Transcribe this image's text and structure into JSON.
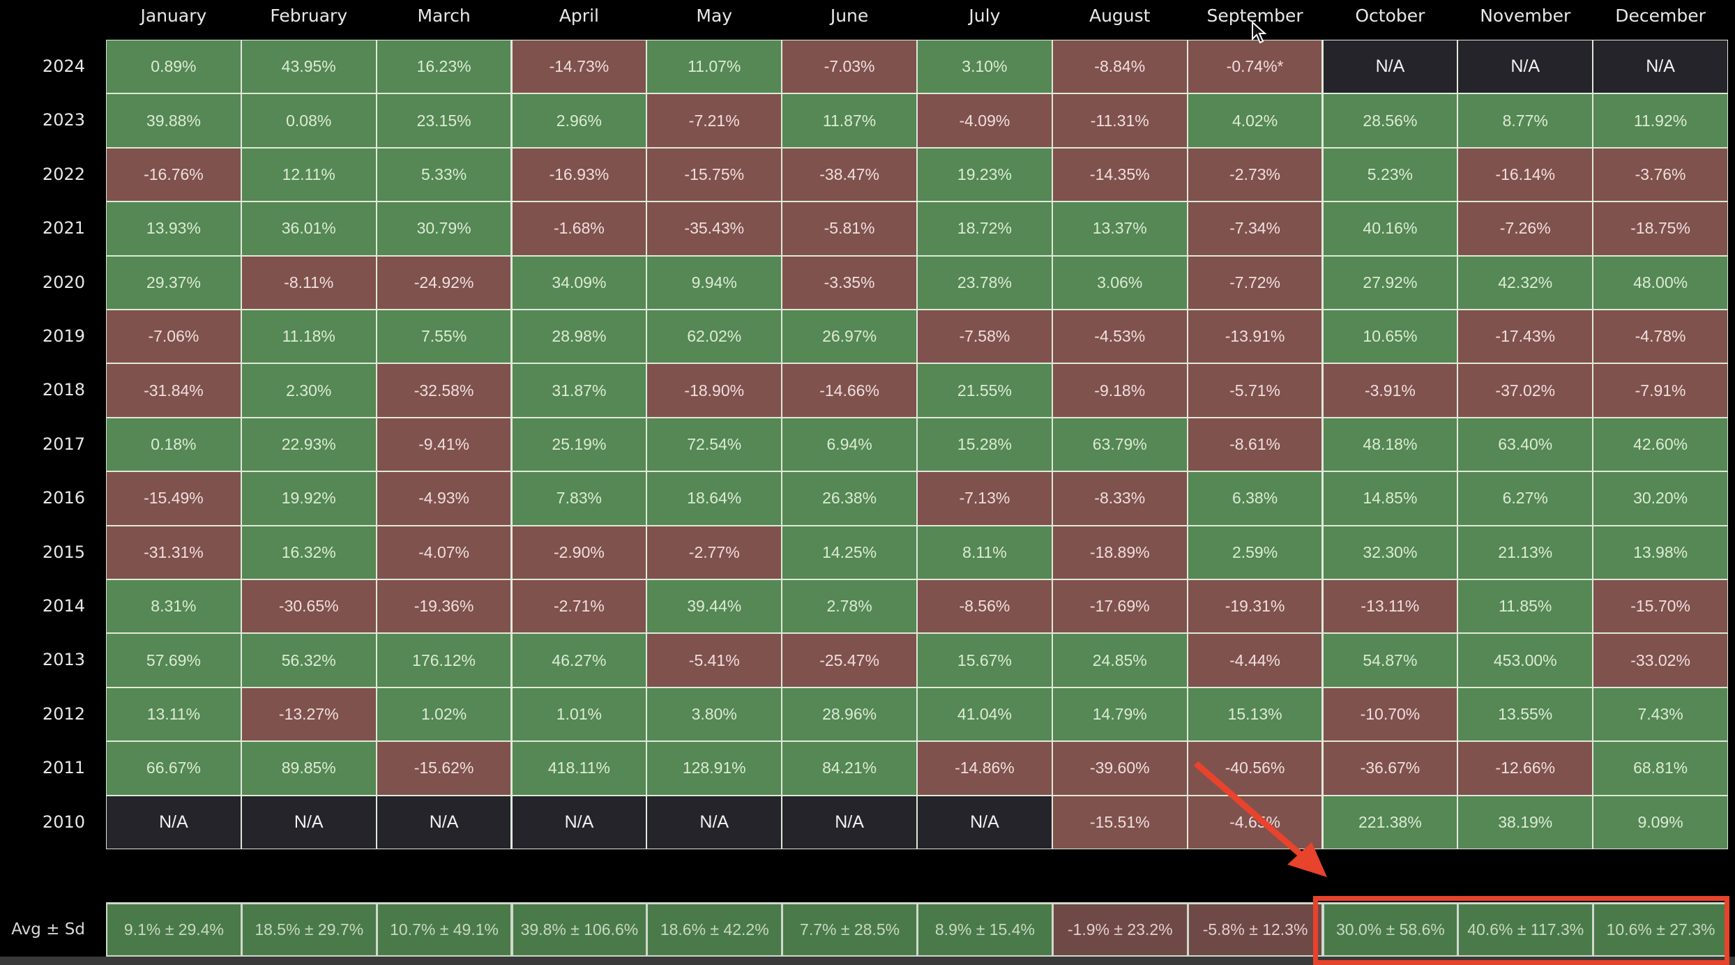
{
  "chart_data": {
    "type": "heatmap",
    "title": "",
    "categories": [
      "January",
      "February",
      "March",
      "April",
      "May",
      "June",
      "July",
      "August",
      "September",
      "October",
      "November",
      "December"
    ],
    "years": [
      "2024",
      "2023",
      "2022",
      "2021",
      "2020",
      "2019",
      "2018",
      "2017",
      "2016",
      "2015",
      "2014",
      "2013",
      "2012",
      "2011",
      "2010"
    ],
    "values": [
      [
        "0.89%",
        "43.95%",
        "16.23%",
        "-14.73%",
        "11.07%",
        "-7.03%",
        "3.10%",
        "-8.84%",
        "-0.74%*",
        "N/A",
        "N/A",
        "N/A"
      ],
      [
        "39.88%",
        "0.08%",
        "23.15%",
        "2.96%",
        "-7.21%",
        "11.87%",
        "-4.09%",
        "-11.31%",
        "4.02%",
        "28.56%",
        "8.77%",
        "11.92%"
      ],
      [
        "-16.76%",
        "12.11%",
        "5.33%",
        "-16.93%",
        "-15.75%",
        "-38.47%",
        "19.23%",
        "-14.35%",
        "-2.73%",
        "5.23%",
        "-16.14%",
        "-3.76%"
      ],
      [
        "13.93%",
        "36.01%",
        "30.79%",
        "-1.68%",
        "-35.43%",
        "-5.81%",
        "18.72%",
        "13.37%",
        "-7.34%",
        "40.16%",
        "-7.26%",
        "-18.75%"
      ],
      [
        "29.37%",
        "-8.11%",
        "-24.92%",
        "34.09%",
        "9.94%",
        "-3.35%",
        "23.78%",
        "3.06%",
        "-7.72%",
        "27.92%",
        "42.32%",
        "48.00%"
      ],
      [
        "-7.06%",
        "11.18%",
        "7.55%",
        "28.98%",
        "62.02%",
        "26.97%",
        "-7.58%",
        "-4.53%",
        "-13.91%",
        "10.65%",
        "-17.43%",
        "-4.78%"
      ],
      [
        "-31.84%",
        "2.30%",
        "-32.58%",
        "31.87%",
        "-18.90%",
        "-14.66%",
        "21.55%",
        "-9.18%",
        "-5.71%",
        "-3.91%",
        "-37.02%",
        "-7.91%"
      ],
      [
        "0.18%",
        "22.93%",
        "-9.41%",
        "25.19%",
        "72.54%",
        "6.94%",
        "15.28%",
        "63.79%",
        "-8.61%",
        "48.18%",
        "63.40%",
        "42.60%"
      ],
      [
        "-15.49%",
        "19.92%",
        "-4.93%",
        "7.83%",
        "18.64%",
        "26.38%",
        "-7.13%",
        "-8.33%",
        "6.38%",
        "14.85%",
        "6.27%",
        "30.20%"
      ],
      [
        "-31.31%",
        "16.32%",
        "-4.07%",
        "-2.90%",
        "-2.77%",
        "14.25%",
        "8.11%",
        "-18.89%",
        "2.59%",
        "32.30%",
        "21.13%",
        "13.98%"
      ],
      [
        "8.31%",
        "-30.65%",
        "-19.36%",
        "-2.71%",
        "39.44%",
        "2.78%",
        "-8.56%",
        "-17.69%",
        "-19.31%",
        "-13.11%",
        "11.85%",
        "-15.70%"
      ],
      [
        "57.69%",
        "56.32%",
        "176.12%",
        "46.27%",
        "-5.41%",
        "-25.47%",
        "15.67%",
        "24.85%",
        "-4.44%",
        "54.87%",
        "453.00%",
        "-33.02%"
      ],
      [
        "13.11%",
        "-13.27%",
        "1.02%",
        "1.01%",
        "3.80%",
        "28.96%",
        "41.04%",
        "14.79%",
        "15.13%",
        "-10.70%",
        "13.55%",
        "7.43%"
      ],
      [
        "66.67%",
        "89.85%",
        "-15.62%",
        "418.11%",
        "128.91%",
        "84.21%",
        "-14.86%",
        "-39.60%",
        "-40.56%",
        "-36.67%",
        "-12.66%",
        "68.81%"
      ],
      [
        "N/A",
        "N/A",
        "N/A",
        "N/A",
        "N/A",
        "N/A",
        "N/A",
        "-15.51%",
        "-4.65%",
        "221.38%",
        "38.19%",
        "9.09%"
      ]
    ],
    "summary_label": "Avg ± Sd",
    "summary": [
      "9.1% ± 29.4%",
      "18.5% ± 29.7%",
      "10.7% ± 49.1%",
      "39.8% ± 106.6%",
      "18.6% ± 42.2%",
      "7.7% ± 28.5%",
      "8.9% ± 15.4%",
      "-1.9% ± 23.2%",
      "-5.8% ± 12.3%",
      "30.0% ± 58.6%",
      "40.6% ± 117.3%",
      "10.6% ± 27.3%"
    ],
    "highlighted_summary_months": [
      "October",
      "November",
      "December"
    ],
    "colors": {
      "positive": "#558854",
      "negative": "#80524d",
      "na": "#24242a",
      "annotation": "#e8432c"
    }
  }
}
